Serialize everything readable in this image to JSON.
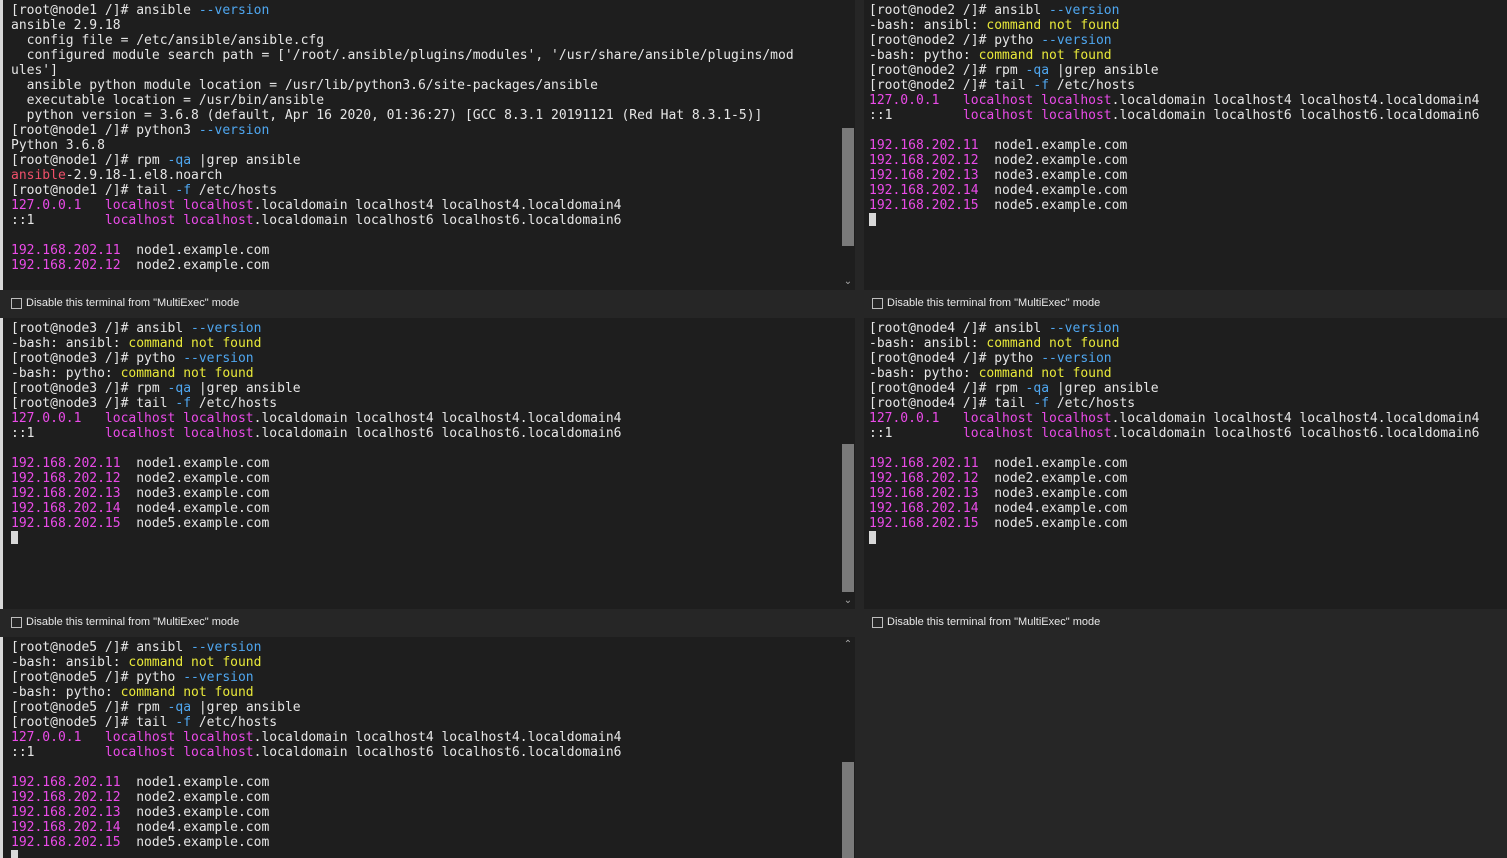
{
  "colors": {
    "background": "#1e1e1e",
    "prompt_text": "#e6e6e6",
    "option": "#4fa7f0",
    "error": "#e8e83a",
    "ip_and_host": "#ea4be8",
    "package": "#f0506a"
  },
  "multiexec_label": "Disable this terminal from \"MultiExec\" mode",
  "terminals": [
    {
      "id": "node1",
      "lines": [
        [
          {
            "t": "[root@node1 /]# ansible ",
            "c": "white"
          },
          {
            "t": "--version",
            "c": "blue"
          }
        ],
        [
          {
            "t": "ansible 2.9.18",
            "c": "white"
          }
        ],
        [
          {
            "t": "  config file = /etc/ansible/ansible.cfg",
            "c": "white"
          }
        ],
        [
          {
            "t": "  configured module search path = ['/root/.ansible/plugins/modules', '/usr/share/ansible/plugins/mod",
            "c": "white"
          }
        ],
        [
          {
            "t": "ules']",
            "c": "white"
          }
        ],
        [
          {
            "t": "  ansible python module location = /usr/lib/python3.6/site-packages/ansible",
            "c": "white"
          }
        ],
        [
          {
            "t": "  executable location = /usr/bin/ansible",
            "c": "white"
          }
        ],
        [
          {
            "t": "  python version = 3.6.8 (default, Apr 16 2020, 01:36:27) [GCC 8.3.1 20191121 (Red Hat 8.3.1-5)]",
            "c": "white"
          }
        ],
        [
          {
            "t": "[root@node1 /]# python3 ",
            "c": "white"
          },
          {
            "t": "--version",
            "c": "blue"
          }
        ],
        [
          {
            "t": "Python 3.6.8",
            "c": "white"
          }
        ],
        [
          {
            "t": "[root@node1 /]# rpm ",
            "c": "white"
          },
          {
            "t": "-qa",
            "c": "blue"
          },
          {
            "t": " |grep ansible",
            "c": "white"
          }
        ],
        [
          {
            "t": "ansible",
            "c": "red"
          },
          {
            "t": "-2.9.18-1.el8.noarch",
            "c": "white"
          }
        ],
        [
          {
            "t": "[root@node1 /]# tail ",
            "c": "white"
          },
          {
            "t": "-f",
            "c": "blue"
          },
          {
            "t": " /etc/hosts",
            "c": "white"
          }
        ],
        [
          {
            "t": "127.0.0.1   localhost localhost",
            "c": "magenta"
          },
          {
            "t": ".localdomain localhost4 localhost4.localdomain4",
            "c": "white"
          }
        ],
        [
          {
            "t": "::1         ",
            "c": "white"
          },
          {
            "t": "localhost localhost",
            "c": "magenta"
          },
          {
            "t": ".localdomain localhost6 localhost6.localdomain6",
            "c": "white"
          }
        ],
        [],
        [
          {
            "t": "192.168.202.11",
            "c": "magenta"
          },
          {
            "t": "  node1.example.com",
            "c": "white"
          }
        ],
        [
          {
            "t": "192.168.202.12",
            "c": "magenta"
          },
          {
            "t": "  node2.example.com",
            "c": "white"
          }
        ]
      ],
      "cursor": false
    },
    {
      "id": "node2",
      "lines": [
        [
          {
            "t": "[root@node2 /]# ansibl ",
            "c": "white"
          },
          {
            "t": "--version",
            "c": "blue"
          }
        ],
        [
          {
            "t": "-bash: ansibl: ",
            "c": "white"
          },
          {
            "t": "command not found",
            "c": "yellow"
          }
        ],
        [
          {
            "t": "[root@node2 /]# pytho ",
            "c": "white"
          },
          {
            "t": "--version",
            "c": "blue"
          }
        ],
        [
          {
            "t": "-bash: pytho: ",
            "c": "white"
          },
          {
            "t": "command not found",
            "c": "yellow"
          }
        ],
        [
          {
            "t": "[root@node2 /]# rpm ",
            "c": "white"
          },
          {
            "t": "-qa",
            "c": "blue"
          },
          {
            "t": " |grep ansible",
            "c": "white"
          }
        ],
        [
          {
            "t": "[root@node2 /]# tail ",
            "c": "white"
          },
          {
            "t": "-f",
            "c": "blue"
          },
          {
            "t": " /etc/hosts",
            "c": "white"
          }
        ],
        [
          {
            "t": "127.0.0.1   localhost localhost",
            "c": "magenta"
          },
          {
            "t": ".localdomain localhost4 localhost4.localdomain4",
            "c": "white"
          }
        ],
        [
          {
            "t": "::1         ",
            "c": "white"
          },
          {
            "t": "localhost localhost",
            "c": "magenta"
          },
          {
            "t": ".localdomain localhost6 localhost6.localdomain6",
            "c": "white"
          }
        ],
        [],
        [
          {
            "t": "192.168.202.11",
            "c": "magenta"
          },
          {
            "t": "  node1.example.com",
            "c": "white"
          }
        ],
        [
          {
            "t": "192.168.202.12",
            "c": "magenta"
          },
          {
            "t": "  node2.example.com",
            "c": "white"
          }
        ],
        [
          {
            "t": "192.168.202.13",
            "c": "magenta"
          },
          {
            "t": "  node3.example.com",
            "c": "white"
          }
        ],
        [
          {
            "t": "192.168.202.14",
            "c": "magenta"
          },
          {
            "t": "  node4.example.com",
            "c": "white"
          }
        ],
        [
          {
            "t": "192.168.202.15",
            "c": "magenta"
          },
          {
            "t": "  node5.example.com",
            "c": "white"
          }
        ]
      ],
      "cursor": true
    },
    {
      "id": "node3",
      "lines": [
        [
          {
            "t": "[root@node3 /]# ansibl ",
            "c": "white"
          },
          {
            "t": "--version",
            "c": "blue"
          }
        ],
        [
          {
            "t": "-bash: ansibl: ",
            "c": "white"
          },
          {
            "t": "command not found",
            "c": "yellow"
          }
        ],
        [
          {
            "t": "[root@node3 /]# pytho ",
            "c": "white"
          },
          {
            "t": "--version",
            "c": "blue"
          }
        ],
        [
          {
            "t": "-bash: pytho: ",
            "c": "white"
          },
          {
            "t": "command not found",
            "c": "yellow"
          }
        ],
        [
          {
            "t": "[root@node3 /]# rpm ",
            "c": "white"
          },
          {
            "t": "-qa",
            "c": "blue"
          },
          {
            "t": " |grep ansible",
            "c": "white"
          }
        ],
        [
          {
            "t": "[root@node3 /]# tail ",
            "c": "white"
          },
          {
            "t": "-f",
            "c": "blue"
          },
          {
            "t": " /etc/hosts",
            "c": "white"
          }
        ],
        [
          {
            "t": "127.0.0.1   localhost localhost",
            "c": "magenta"
          },
          {
            "t": ".localdomain localhost4 localhost4.localdomain4",
            "c": "white"
          }
        ],
        [
          {
            "t": "::1         ",
            "c": "white"
          },
          {
            "t": "localhost localhost",
            "c": "magenta"
          },
          {
            "t": ".localdomain localhost6 localhost6.localdomain6",
            "c": "white"
          }
        ],
        [],
        [
          {
            "t": "192.168.202.11",
            "c": "magenta"
          },
          {
            "t": "  node1.example.com",
            "c": "white"
          }
        ],
        [
          {
            "t": "192.168.202.12",
            "c": "magenta"
          },
          {
            "t": "  node2.example.com",
            "c": "white"
          }
        ],
        [
          {
            "t": "192.168.202.13",
            "c": "magenta"
          },
          {
            "t": "  node3.example.com",
            "c": "white"
          }
        ],
        [
          {
            "t": "192.168.202.14",
            "c": "magenta"
          },
          {
            "t": "  node4.example.com",
            "c": "white"
          }
        ],
        [
          {
            "t": "192.168.202.15",
            "c": "magenta"
          },
          {
            "t": "  node5.example.com",
            "c": "white"
          }
        ]
      ],
      "cursor": true
    },
    {
      "id": "node4",
      "lines": [
        [
          {
            "t": "[root@node4 /]# ansibl ",
            "c": "white"
          },
          {
            "t": "--version",
            "c": "blue"
          }
        ],
        [
          {
            "t": "-bash: ansibl: ",
            "c": "white"
          },
          {
            "t": "command not found",
            "c": "yellow"
          }
        ],
        [
          {
            "t": "[root@node4 /]# pytho ",
            "c": "white"
          },
          {
            "t": "--version",
            "c": "blue"
          }
        ],
        [
          {
            "t": "-bash: pytho: ",
            "c": "white"
          },
          {
            "t": "command not found",
            "c": "yellow"
          }
        ],
        [
          {
            "t": "[root@node4 /]# rpm ",
            "c": "white"
          },
          {
            "t": "-qa",
            "c": "blue"
          },
          {
            "t": " |grep ansible",
            "c": "white"
          }
        ],
        [
          {
            "t": "[root@node4 /]# tail ",
            "c": "white"
          },
          {
            "t": "-f",
            "c": "blue"
          },
          {
            "t": " /etc/hosts",
            "c": "white"
          }
        ],
        [
          {
            "t": "127.0.0.1   localhost localhost",
            "c": "magenta"
          },
          {
            "t": ".localdomain localhost4 localhost4.localdomain4",
            "c": "white"
          }
        ],
        [
          {
            "t": "::1         ",
            "c": "white"
          },
          {
            "t": "localhost localhost",
            "c": "magenta"
          },
          {
            "t": ".localdomain localhost6 localhost6.localdomain6",
            "c": "white"
          }
        ],
        [],
        [
          {
            "t": "192.168.202.11",
            "c": "magenta"
          },
          {
            "t": "  node1.example.com",
            "c": "white"
          }
        ],
        [
          {
            "t": "192.168.202.12",
            "c": "magenta"
          },
          {
            "t": "  node2.example.com",
            "c": "white"
          }
        ],
        [
          {
            "t": "192.168.202.13",
            "c": "magenta"
          },
          {
            "t": "  node3.example.com",
            "c": "white"
          }
        ],
        [
          {
            "t": "192.168.202.14",
            "c": "magenta"
          },
          {
            "t": "  node4.example.com",
            "c": "white"
          }
        ],
        [
          {
            "t": "192.168.202.15",
            "c": "magenta"
          },
          {
            "t": "  node5.example.com",
            "c": "white"
          }
        ]
      ],
      "cursor": true
    },
    {
      "id": "node5",
      "lines": [
        [
          {
            "t": "[root@node5 /]# ansibl ",
            "c": "white"
          },
          {
            "t": "--version",
            "c": "blue"
          }
        ],
        [
          {
            "t": "-bash: ansibl: ",
            "c": "white"
          },
          {
            "t": "command not found",
            "c": "yellow"
          }
        ],
        [
          {
            "t": "[root@node5 /]# pytho ",
            "c": "white"
          },
          {
            "t": "--version",
            "c": "blue"
          }
        ],
        [
          {
            "t": "-bash: pytho: ",
            "c": "white"
          },
          {
            "t": "command not found",
            "c": "yellow"
          }
        ],
        [
          {
            "t": "[root@node5 /]# rpm ",
            "c": "white"
          },
          {
            "t": "-qa",
            "c": "blue"
          },
          {
            "t": " |grep ansible",
            "c": "white"
          }
        ],
        [
          {
            "t": "[root@node5 /]# tail ",
            "c": "white"
          },
          {
            "t": "-f",
            "c": "blue"
          },
          {
            "t": " /etc/hosts",
            "c": "white"
          }
        ],
        [
          {
            "t": "127.0.0.1   localhost localhost",
            "c": "magenta"
          },
          {
            "t": ".localdomain localhost4 localhost4.localdomain4",
            "c": "white"
          }
        ],
        [
          {
            "t": "::1         ",
            "c": "white"
          },
          {
            "t": "localhost localhost",
            "c": "magenta"
          },
          {
            "t": ".localdomain localhost6 localhost6.localdomain6",
            "c": "white"
          }
        ],
        [],
        [
          {
            "t": "192.168.202.11",
            "c": "magenta"
          },
          {
            "t": "  node1.example.com",
            "c": "white"
          }
        ],
        [
          {
            "t": "192.168.202.12",
            "c": "magenta"
          },
          {
            "t": "  node2.example.com",
            "c": "white"
          }
        ],
        [
          {
            "t": "192.168.202.13",
            "c": "magenta"
          },
          {
            "t": "  node3.example.com",
            "c": "white"
          }
        ],
        [
          {
            "t": "192.168.202.14",
            "c": "magenta"
          },
          {
            "t": "  node4.example.com",
            "c": "white"
          }
        ],
        [
          {
            "t": "192.168.202.15",
            "c": "magenta"
          },
          {
            "t": "  node5.example.com",
            "c": "white"
          }
        ]
      ],
      "cursor": true
    }
  ]
}
